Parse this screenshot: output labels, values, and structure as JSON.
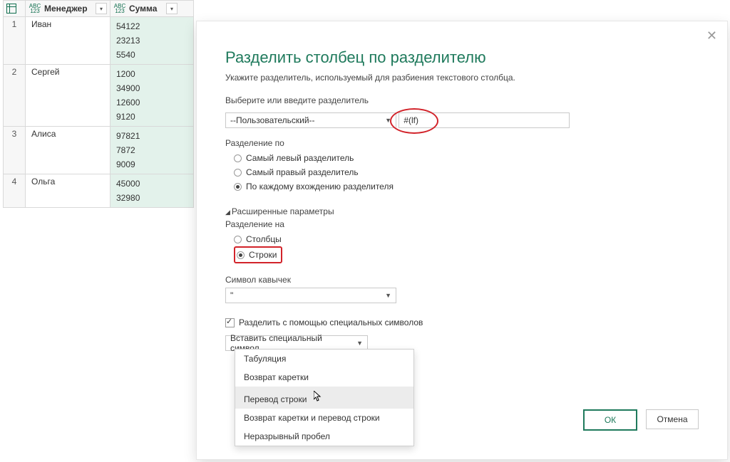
{
  "table": {
    "columns": [
      {
        "label": "Менеджер",
        "type_top": "ABC",
        "type_bot": "123"
      },
      {
        "label": "Сумма",
        "type_top": "ABC",
        "type_bot": "123"
      }
    ],
    "rows": [
      {
        "n": "1",
        "manager": "Иван",
        "amounts": [
          "54122",
          "23213",
          "5540"
        ]
      },
      {
        "n": "2",
        "manager": "Сергей",
        "amounts": [
          "1200",
          "34900",
          "12600",
          "9120"
        ]
      },
      {
        "n": "3",
        "manager": "Алиса",
        "amounts": [
          "97821",
          "7872",
          "9009"
        ]
      },
      {
        "n": "4",
        "manager": "Ольга",
        "amounts": [
          "45000",
          "32980"
        ]
      }
    ]
  },
  "dialog": {
    "title": "Разделить столбец по разделителю",
    "description": "Укажите разделитель, используемый для разбиения текстового столбца.",
    "delimiter_label": "Выберите или введите разделитель",
    "delimiter_combo": "--Пользовательский--",
    "delimiter_value": "#(lf)",
    "split_by_label": "Разделение по",
    "split_by_options": {
      "left": "Самый левый разделитель",
      "right": "Самый правый разделитель",
      "each": "По каждому вхождению разделителя"
    },
    "advanced_label": "Расширенные параметры",
    "split_to_label": "Разделение на",
    "split_to_options": {
      "columns": "Столбцы",
      "rows": "Строки"
    },
    "quote_label": "Символ кавычек",
    "quote_value": "\"",
    "special_checkbox": "Разделить с помощью специальных символов",
    "insert_special_button": "Вставить специальный символ",
    "menu": {
      "tab": "Табуляция",
      "cr": "Возврат каретки",
      "lf": "Перевод строки",
      "crlf": "Возврат каретки и перевод строки",
      "nbsp": "Неразрывный пробел"
    },
    "ok": "ОК",
    "cancel": "Отмена"
  }
}
